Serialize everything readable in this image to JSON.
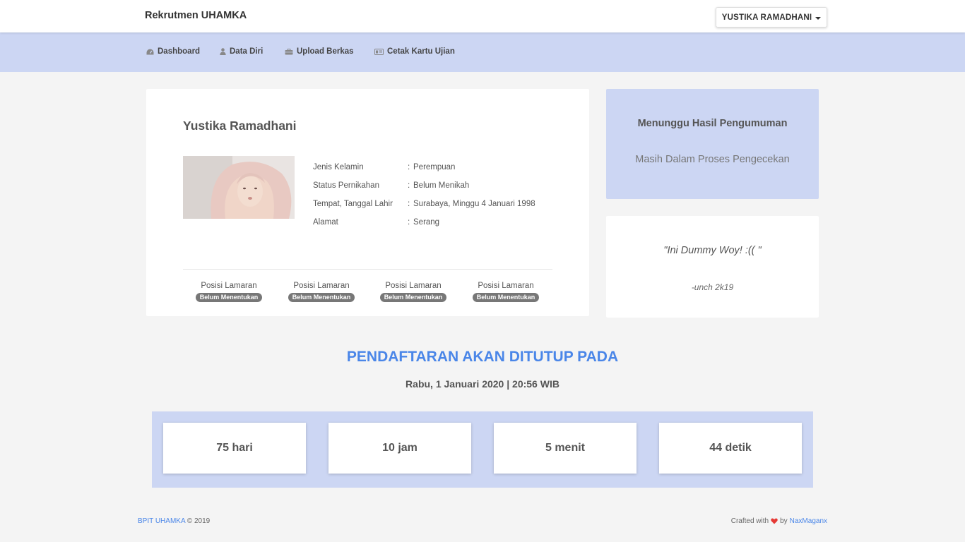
{
  "header": {
    "brand": "Rekrutmen UHAMKA",
    "user_menu": "YUSTIKA RAMADHANI"
  },
  "nav": {
    "items": [
      {
        "label": "Dashboard",
        "icon": "dashboard-icon"
      },
      {
        "label": "Data Diri",
        "icon": "user-icon"
      },
      {
        "label": "Upload Berkas",
        "icon": "briefcase-icon"
      },
      {
        "label": "Cetak Kartu Ujian",
        "icon": "id-card-icon"
      }
    ]
  },
  "profile": {
    "name": "Yustika Ramadhani",
    "fields": [
      {
        "label": "Jenis Kelamin",
        "value": "Perempuan"
      },
      {
        "label": "Status Pernikahan",
        "value": "Belum Menikah"
      },
      {
        "label": "Tempat, Tanggal Lahir",
        "value": "Surabaya, Minggu 4 Januari 1998"
      },
      {
        "label": "Alamat",
        "value": "Serang"
      }
    ],
    "colon": ":",
    "positions": [
      {
        "label": "Posisi Lamaran",
        "status": "Belum Menentukan"
      },
      {
        "label": "Posisi Lamaran",
        "status": "Belum Menentukan"
      },
      {
        "label": "Posisi Lamaran",
        "status": "Belum Menentukan"
      },
      {
        "label": "Posisi Lamaran",
        "status": "Belum Menentukan"
      }
    ]
  },
  "status": {
    "title": "Menunggu Hasil Pengumuman",
    "subtitle": "Masih Dalam Proses Pengecekan"
  },
  "quote": {
    "text": "\"Ini Dummy Woy! :(( \"",
    "author": "-unch 2k19"
  },
  "deadline": {
    "title": "PENDAFTARAN AKAN DITUTUP PADA",
    "date": "Rabu, 1 Januari 2020 | 20:56 WIB"
  },
  "countdown": [
    "75 hari",
    "10 jam",
    "5 menit",
    "44 detik"
  ],
  "footer": {
    "org": "BPIT UHAMKA",
    "copyright": "© 2019",
    "crafted": "Crafted with",
    "by": "by",
    "author": "NaxMaganx"
  },
  "colors": {
    "accent": "#4a86e8",
    "nav_bg": "#ccd6f3",
    "heart": "#e53935"
  }
}
